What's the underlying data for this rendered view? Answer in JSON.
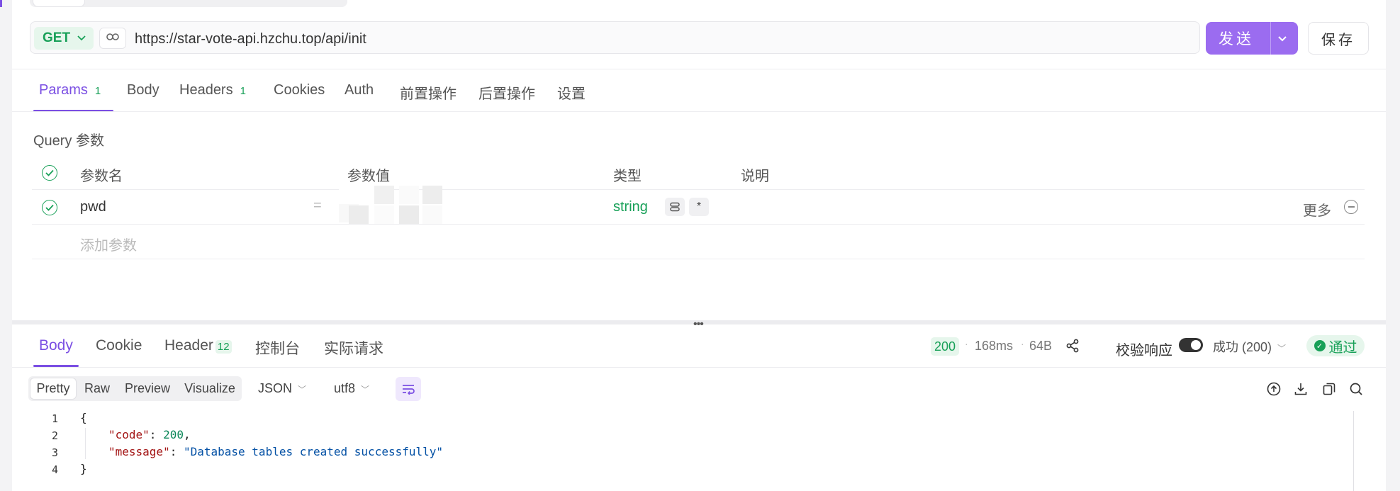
{
  "request": {
    "method": "GET",
    "url": "https://star-vote-api.hzchu.top/api/init",
    "send_label": "发送",
    "save_label": "保存"
  },
  "request_tabs": [
    {
      "label": "Params",
      "badge": "1",
      "active": true
    },
    {
      "label": "Body"
    },
    {
      "label": "Headers",
      "badge": "1"
    },
    {
      "label": "Cookies"
    },
    {
      "label": "Auth"
    },
    {
      "label": "前置操作"
    },
    {
      "label": "后置操作"
    },
    {
      "label": "设置"
    }
  ],
  "params": {
    "section_title": "Query 参数",
    "columns": [
      "参数名",
      "参数值",
      "类型",
      "说明"
    ],
    "rows": [
      {
        "name": "pwd",
        "type": "string",
        "required_marker": "*",
        "more_label": "更多",
        "checked": true
      }
    ],
    "add_placeholder": "添加参数"
  },
  "response_tabs": [
    {
      "label": "Body",
      "active": true
    },
    {
      "label": "Cookie"
    },
    {
      "label": "Header",
      "badge": "12"
    },
    {
      "label": "控制台"
    },
    {
      "label": "实际请求"
    }
  ],
  "response_meta": {
    "status": "200",
    "time": "168ms",
    "size": "64B",
    "validate_label": "校验响应",
    "validate_on": true,
    "status_select": "成功 (200)",
    "result_badge": "通过"
  },
  "view_modes": [
    "Pretty",
    "Raw",
    "Preview",
    "Visualize"
  ],
  "format": "JSON",
  "encoding": "utf8",
  "code_lines": {
    "numbers": [
      "1",
      "2",
      "3",
      "4"
    ],
    "open_brace": "{",
    "code_key": "\"code\"",
    "code_value": "200",
    "message_key": "\"message\"",
    "message_value": "\"Database tables created successfully\"",
    "close_brace": "}"
  },
  "colors": {
    "accent": "#7b4fe3",
    "send_button": "#9b6cf0",
    "success": "#18a058"
  }
}
